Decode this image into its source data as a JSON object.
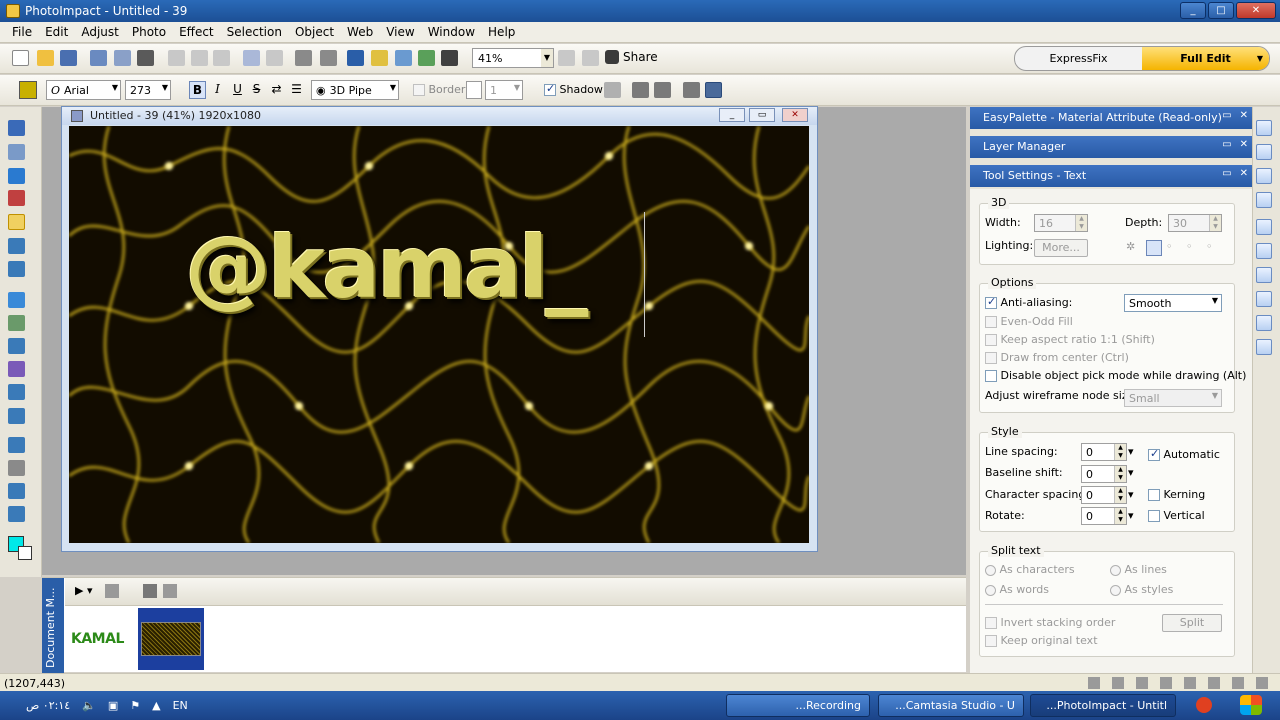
{
  "window": {
    "title": "PhotoImpact - Untitled - 39"
  },
  "menu": [
    "File",
    "Edit",
    "Adjust",
    "Photo",
    "Effect",
    "Selection",
    "Object",
    "Web",
    "View",
    "Window",
    "Help"
  ],
  "toolbar": {
    "zoom": "41%",
    "share_label": "Share",
    "mode_express": "ExpressFix",
    "mode_full": "Full Edit"
  },
  "text_toolbar": {
    "font": "Arial",
    "size": "273",
    "bold": "B",
    "italic": "I",
    "underline": "U",
    "strike": "S",
    "style_3d": "3D Pipe",
    "border_label": "Border",
    "border_width": "1",
    "shadow_label": "Shadow"
  },
  "document": {
    "title": "Untitled - 39 (41%) 1920x1080",
    "canvas_text": "@kamal_"
  },
  "doc_manager": {
    "label": "Document M...",
    "thumb1_text": "KAMAL"
  },
  "status": {
    "coords": "(1207,443)"
  },
  "panels": {
    "easypalette": "EasyPalette - Material Attribute (Read-only)",
    "layer_manager": "Layer Manager",
    "tool_settings": "Tool Settings - Text"
  },
  "settings": {
    "group_3d": "3D",
    "width_label": "Width:",
    "width_value": "16",
    "depth_label": "Depth:",
    "depth_value": "30",
    "lighting_label": "Lighting:",
    "more_label": "More...",
    "options_title": "Options",
    "anti_aliasing": "Anti-aliasing:",
    "anti_aliasing_value": "Smooth",
    "even_odd": "Even-Odd Fill",
    "keep_aspect": "Keep aspect ratio 1:1 (Shift)",
    "draw_center": "Draw from center (Ctrl)",
    "disable_pick": "Disable object pick mode while drawing (Alt)",
    "wireframe_label": "Adjust wireframe node size:",
    "wireframe_value": "Small",
    "style_title": "Style",
    "line_spacing": "Line spacing:",
    "line_spacing_value": "0",
    "automatic": "Automatic",
    "baseline_shift": "Baseline shift:",
    "baseline_value": "0",
    "char_spacing": "Character spacing:",
    "char_spacing_value": "0",
    "kerning": "Kerning",
    "rotate": "Rotate:",
    "rotate_value": "0",
    "vertical": "Vertical",
    "split_title": "Split text",
    "as_characters": "As characters",
    "as_lines": "As lines",
    "as_words": "As words",
    "as_styles": "As styles",
    "invert_order": "Invert stacking order",
    "keep_original": "Keep original text",
    "split_button": "Split"
  },
  "taskbar": {
    "time": "٠٢:١٤ ص",
    "lang": "EN",
    "tasks": [
      "...Recording",
      "...Camtasia Studio - U",
      "...PhotoImpact - Untitl"
    ]
  }
}
